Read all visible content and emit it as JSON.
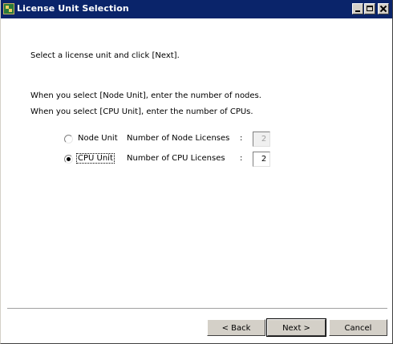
{
  "window": {
    "title": "License Unit Selection"
  },
  "content": {
    "instruction": "Select a license unit and click [Next].",
    "note_node": "When you select [Node Unit], enter the number of nodes.",
    "note_cpu": "When you select [CPU Unit],  enter the number of CPUs."
  },
  "options": {
    "node": {
      "label": "Node Unit",
      "count_label": "Number of Node Licenses",
      "colon": ":",
      "value": "2",
      "selected": false,
      "enabled": false
    },
    "cpu": {
      "label": "CPU Unit",
      "count_label": "Number of CPU Licenses",
      "colon": ":",
      "value": "2",
      "selected": true,
      "enabled": true
    }
  },
  "buttons": {
    "back": "< Back",
    "next": "Next >",
    "cancel": "Cancel"
  }
}
